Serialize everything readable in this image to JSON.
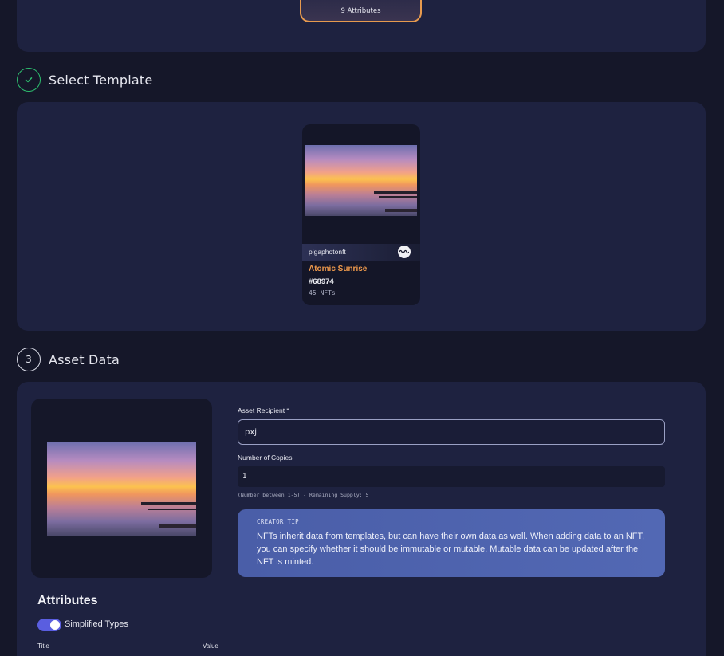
{
  "collection_card": {
    "attributes_label": "9 Attributes"
  },
  "steps": [
    {
      "label": "Select Template",
      "status": "done",
      "icon": "check-icon"
    },
    {
      "number": "3",
      "label": "Asset Data"
    }
  ],
  "template_card": {
    "owner": "pigaphotonft",
    "owner_icon": "wave-logo-icon",
    "name": "Atomic Sunrise",
    "id": "#68974",
    "count": "45 NFTs"
  },
  "asset_form": {
    "recipient_label": "Asset Recipient *",
    "recipient_value": "pxj",
    "copies_label": "Number of Copies",
    "copies_value": "1",
    "copies_hint": "(Number between 1-5) - Remaining Supply: 5"
  },
  "creator_tip": {
    "title": "CREATOR TIP",
    "text": "NFTs inherit data from templates, but can have their own data as well. When adding data to an NFT, you can specify whether it should be immutable or mutable. Mutable data can be updated after the NFT is minted."
  },
  "attributes": {
    "heading": "Attributes",
    "toggle_label": "Simplified Types",
    "toggle_on": true,
    "columns": [
      "Title",
      "Value"
    ]
  },
  "colors": {
    "accent_orange": "#e79a4e",
    "success_green": "#2dbd6e",
    "toggle_purple": "#5a5ee0",
    "tip_blue": "#4a5ea8"
  }
}
